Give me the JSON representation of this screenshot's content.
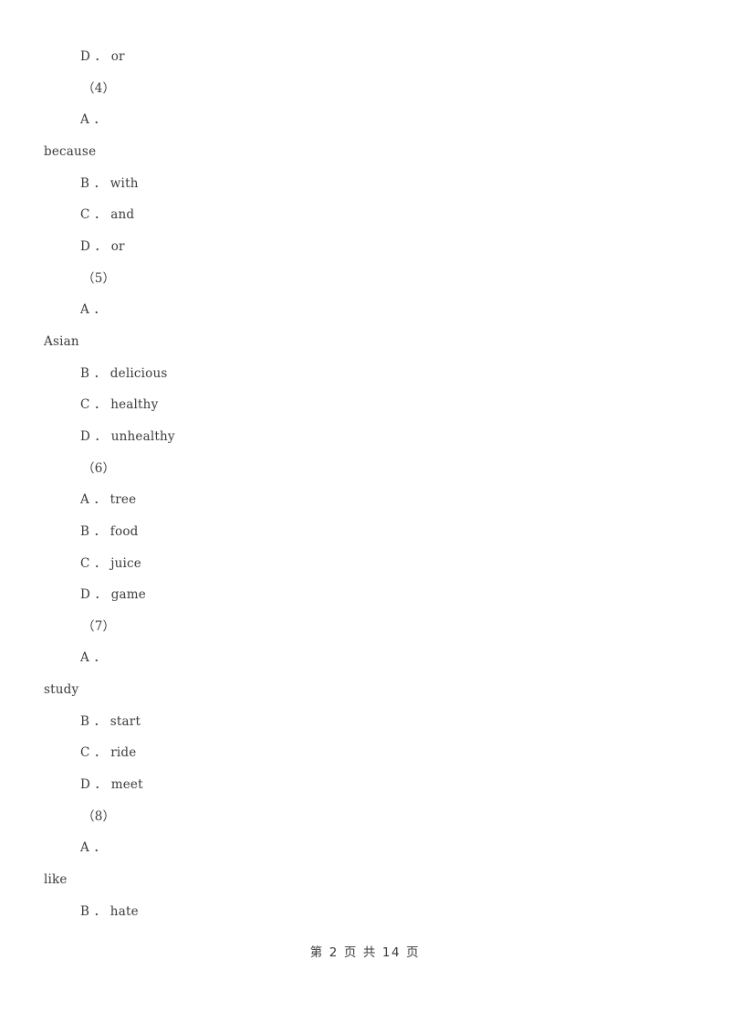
{
  "document": {
    "page_background": "#ffffff",
    "text_color": "#3a3a3a",
    "footer": "第 2 页 共 14 页"
  },
  "lines": [
    {
      "text": "D ． or",
      "style": "indent"
    },
    {
      "text": "（4）",
      "style": "qnum"
    },
    {
      "text": "A ．",
      "style": "indent"
    },
    {
      "text": "because",
      "style": "flush"
    },
    {
      "text": "B ． with",
      "style": "indent"
    },
    {
      "text": "C ． and",
      "style": "indent"
    },
    {
      "text": "D ． or",
      "style": "indent"
    },
    {
      "text": "（5）",
      "style": "qnum"
    },
    {
      "text": "A ．",
      "style": "indent"
    },
    {
      "text": "Asian",
      "style": "flush"
    },
    {
      "text": "B ． delicious",
      "style": "indent"
    },
    {
      "text": "C ． healthy",
      "style": "indent"
    },
    {
      "text": "D ． unhealthy",
      "style": "indent"
    },
    {
      "text": "（6）",
      "style": "qnum"
    },
    {
      "text": "A ． tree",
      "style": "indent"
    },
    {
      "text": "B ． food",
      "style": "indent"
    },
    {
      "text": "C ． juice",
      "style": "indent"
    },
    {
      "text": "D ． game",
      "style": "indent"
    },
    {
      "text": "（7）",
      "style": "qnum"
    },
    {
      "text": "A ．",
      "style": "indent"
    },
    {
      "text": "study",
      "style": "flush"
    },
    {
      "text": "B ． start",
      "style": "indent"
    },
    {
      "text": "C ． ride",
      "style": "indent"
    },
    {
      "text": "D ． meet",
      "style": "indent"
    },
    {
      "text": "（8）",
      "style": "qnum"
    },
    {
      "text": "A ．",
      "style": "indent"
    },
    {
      "text": "like",
      "style": "flush"
    },
    {
      "text": "B ． hate",
      "style": "indent"
    }
  ]
}
